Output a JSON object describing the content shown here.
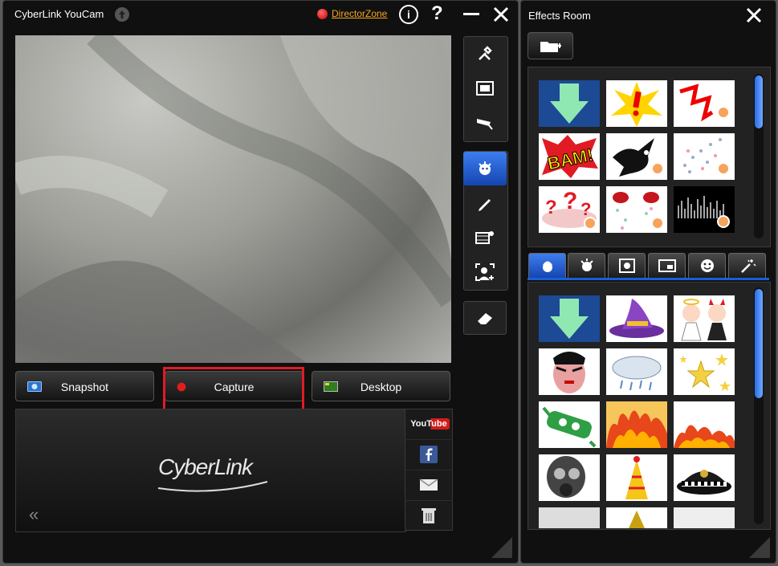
{
  "app": {
    "title": "CyberLink YouCam",
    "director_link": "DirectorZone",
    "info_glyph": "i",
    "help_glyph": "?"
  },
  "buttons": {
    "snapshot": "Snapshot",
    "capture": "Capture",
    "desktop": "Desktop"
  },
  "preview": {
    "brand_logo": "CyberLink"
  },
  "share": {
    "youtube": "YouTube"
  },
  "effects": {
    "title": "Effects Room",
    "top_grid": [
      "download-icon",
      "exclamation-burst",
      "red-lightning",
      "bam-comic",
      "bird-silhouette",
      "confetti",
      "question-marks",
      "confetti-pops",
      "equalizer-bars"
    ],
    "bottom_grid": [
      "download-icon",
      "witch-hat",
      "angel-devil",
      "opera-mask",
      "rain-cloud",
      "gold-stars",
      "green-robot",
      "fire",
      "fire-small",
      "gas-mask",
      "party-hat",
      "police-hat"
    ],
    "tabs": [
      "avatar-tab-icon",
      "emotion-tab-icon",
      "frame-tab-icon",
      "scene-tab-icon",
      "smiley-tab-icon",
      "magic-wand-tab-icon"
    ]
  },
  "colors": {
    "accent_blue": "#1a5fd6",
    "highlight_red": "#e01b24",
    "link_orange": "#f5a623"
  }
}
